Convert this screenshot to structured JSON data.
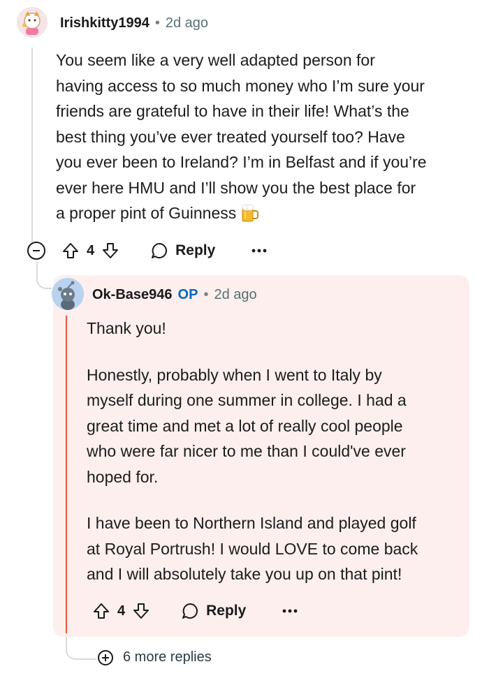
{
  "comment": {
    "username": "Irishkitty1994",
    "time": "2d ago",
    "dot": "•",
    "lines": [
      "You seem like a very well adapted person for",
      "having access to so much money who I’m sure your",
      "friends are grateful to have in their life! What’s the",
      "best thing you’ve ever treated yourself too? Have",
      "you ever been to Ireland? I’m in Belfast and if you’re",
      "ever here HMU and I’ll show you the best place for",
      "a proper pint of Guinness"
    ],
    "emoji_icon": "beer-mug-icon",
    "votes": "4",
    "reply_label": "Reply"
  },
  "reply": {
    "username": "Ok-Base946",
    "op_badge": "OP",
    "time": "2d ago",
    "dot": "•",
    "paragraph1": "Thank you!",
    "paragraph2_lines": [
      "Honestly, probably when I went to Italy by",
      "myself during one summer in college. I had a",
      "great time and met a lot of really cool people",
      "who were far nicer to me than I could've ever",
      "hoped for."
    ],
    "paragraph3_lines": [
      "I have been to Northern Island and played golf",
      "at Royal Portrush! I would LOVE to come back",
      "and I will absolutely take you up on that pint!"
    ],
    "votes": "4",
    "reply_label": "Reply"
  },
  "more_replies": "6 more replies",
  "colors": {
    "op_badge": "#0a66c2",
    "op_line": "#e0593f",
    "reply_card_bg": "#fcefed",
    "thread_line": "#d7dadc"
  }
}
